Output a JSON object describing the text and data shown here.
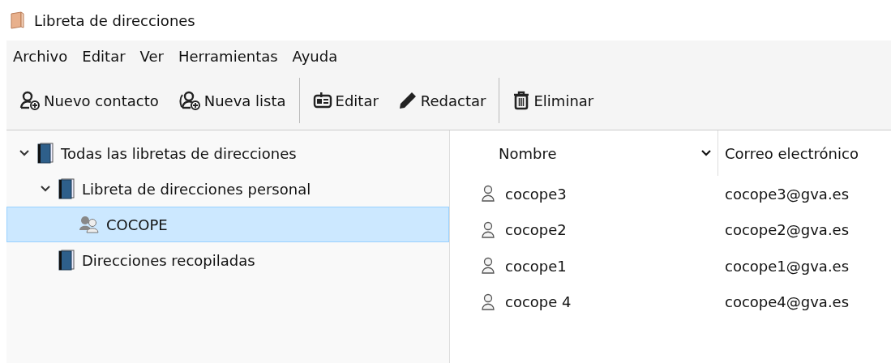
{
  "window": {
    "title": "Libreta de direcciones"
  },
  "menu": [
    "Archivo",
    "Editar",
    "Ver",
    "Herramientas",
    "Ayuda"
  ],
  "toolbar": {
    "groups": [
      [
        "Nuevo contacto",
        "Nueva lista"
      ],
      [
        "Editar",
        "Redactar"
      ],
      [
        "Eliminar"
      ]
    ]
  },
  "tree": [
    {
      "label": "Todas las libretas de direcciones",
      "kind": "book",
      "expanded": true,
      "selected": false,
      "children": [
        {
          "label": "Libreta de direcciones personal",
          "kind": "book",
          "expanded": true,
          "selected": false,
          "children": [
            {
              "label": "COCOPE",
              "kind": "list",
              "selected": true
            }
          ]
        },
        {
          "label": "Direcciones recopiladas",
          "kind": "book",
          "selected": false
        }
      ]
    }
  ],
  "table": {
    "columns": [
      {
        "label": "Nombre",
        "sorted": true
      },
      {
        "label": "Correo electrónico",
        "sorted": false
      }
    ],
    "rows": [
      [
        "cocope3",
        "cocope3@gva.es"
      ],
      [
        "cocope2",
        "cocope2@gva.es"
      ],
      [
        "cocope1",
        "cocope1@gva.es"
      ],
      [
        "cocope 4",
        "cocope4@gva.es"
      ]
    ]
  }
}
